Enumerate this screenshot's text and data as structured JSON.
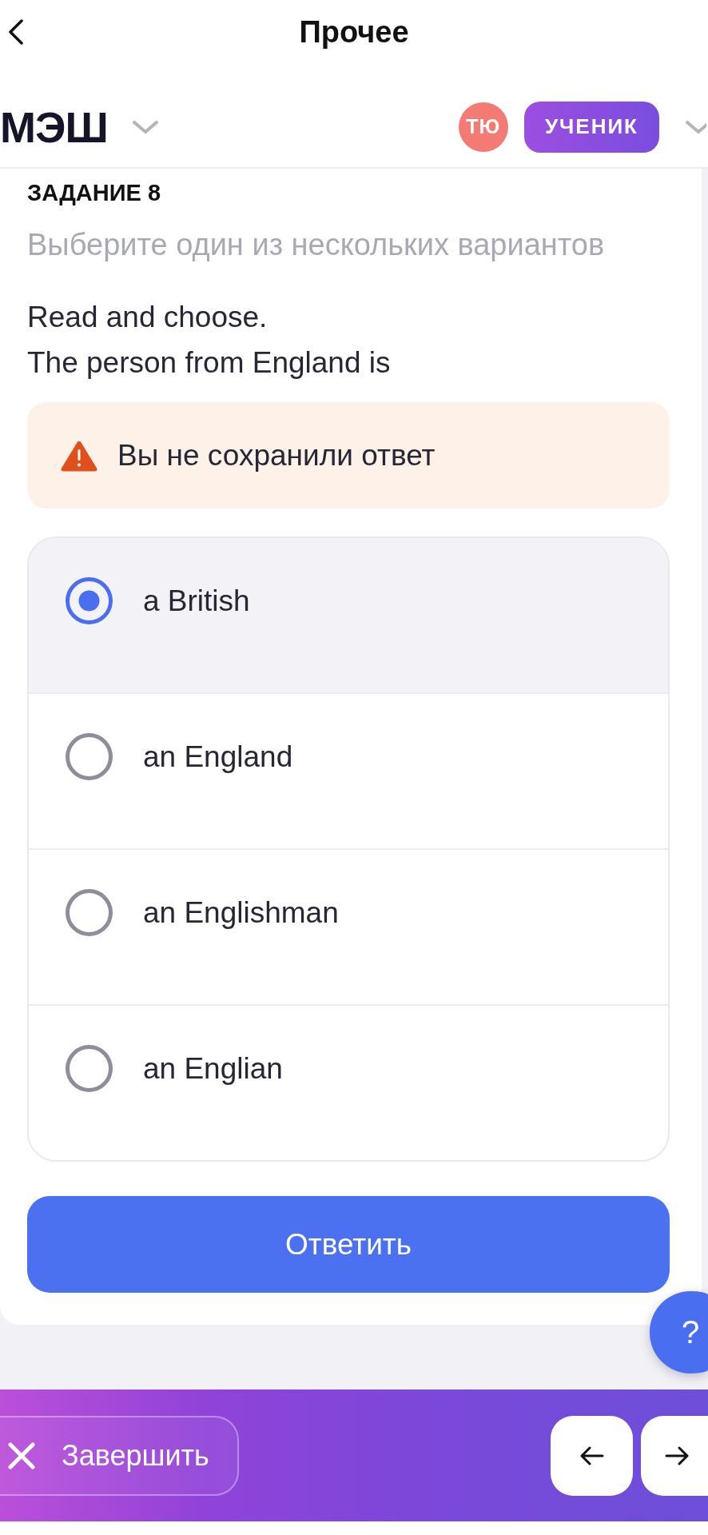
{
  "top_bar": {
    "title": "Прочее"
  },
  "app_header": {
    "logo": "МЭШ",
    "avatar_initials": "ТЮ",
    "role": "УЧЕНИК"
  },
  "task": {
    "heading": "ЗАДАНИЕ 8",
    "instruction": "Выберите один из нескольких вариантов",
    "question_lines": [
      "Read and choose.",
      "The person from England is"
    ]
  },
  "warning": {
    "text": "Вы не сохранили ответ"
  },
  "options": [
    {
      "label": "a British",
      "selected": true
    },
    {
      "label": "an England",
      "selected": false
    },
    {
      "label": "an Englishman",
      "selected": false
    },
    {
      "label": "an Englian",
      "selected": false
    }
  ],
  "submit_button": {
    "label": "Ответить"
  },
  "help_button": {
    "label": "?"
  },
  "bottom_bar": {
    "finish_button": {
      "label": "Завершить"
    }
  }
}
